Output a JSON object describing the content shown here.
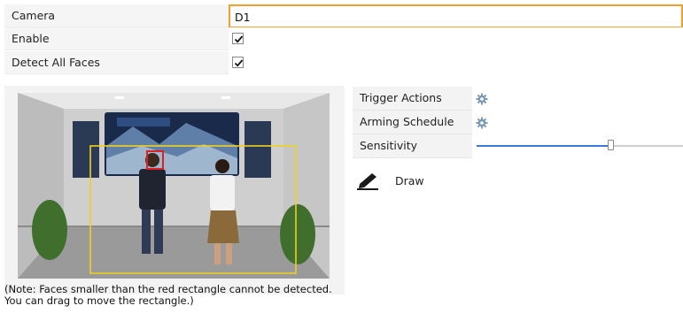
{
  "form": {
    "camera_label": "Camera",
    "camera_value": "D1",
    "enable_label": "Enable",
    "enable_checked": true,
    "detect_faces_label": "Detect All Faces",
    "detect_faces_checked": true
  },
  "video": {
    "note": "(Note: Faces smaller than the red rectangle cannot be detected. You can drag to move the rectangle.)"
  },
  "side": {
    "trigger_label": "Trigger Actions",
    "trigger_icon": "gear-icon",
    "arming_label": "Arming Schedule",
    "arming_icon": "gear-icon",
    "sensitivity_label": "Sensitivity",
    "sensitivity_fraction": 0.65,
    "draw_label": "Draw",
    "draw_icon": "pencil-icon"
  },
  "colors": {
    "focus_border": "#f2a02e",
    "slider_fill": "#3b78d8",
    "detection_rect": "#f0d020",
    "face_rect": "#e02020"
  }
}
